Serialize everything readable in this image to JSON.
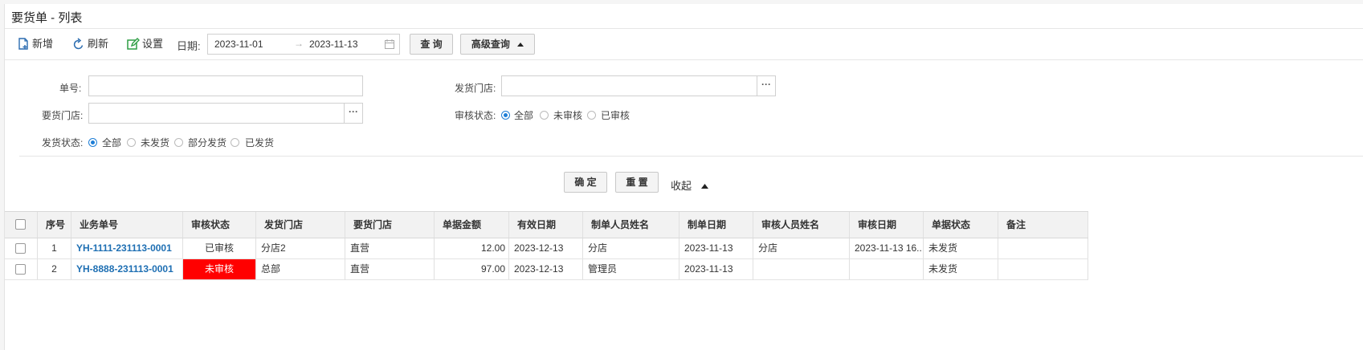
{
  "title": "要货单 - 列表",
  "toolbar": {
    "new_label": "新增",
    "refresh_label": "刷新",
    "settings_label": "设置",
    "date_label": "日期:",
    "date_from": "2023-11-01",
    "date_arrow": "→",
    "date_to": "2023-11-13",
    "query_label": "查 询",
    "advanced_label": "高级查询"
  },
  "filters": {
    "order_no_label": "单号:",
    "ship_store_label": "发货门店:",
    "req_store_label": "要货门店:",
    "audit_status_label": "审核状态:",
    "audit_options": [
      "全部",
      "未审核",
      "已审核"
    ],
    "ship_status_label": "发货状态:",
    "ship_options": [
      "全部",
      "未发货",
      "部分发货",
      "已发货"
    ],
    "ellipsis": "···",
    "confirm_label": "确 定",
    "reset_label": "重 置",
    "collapse_label": "收起"
  },
  "table": {
    "headers": [
      "序号",
      "业务单号",
      "审核状态",
      "发货门店",
      "要货门店",
      "单据金额",
      "有效日期",
      "制单人员姓名",
      "制单日期",
      "审核人员姓名",
      "审核日期",
      "单据状态",
      "备注"
    ],
    "rows": [
      [
        "1",
        "YH-1111-231113-0001",
        "已审核",
        "分店2",
        "直营",
        "12.00",
        "2023-12-13",
        "分店",
        "2023-11-13",
        "分店",
        "2023-11-13 16...",
        "未发货",
        ""
      ],
      [
        "2",
        "YH-8888-231113-0001",
        "未审核",
        "总部",
        "直营",
        "97.00",
        "2023-12-13",
        "管理员",
        "2023-11-13",
        "",
        "",
        "未发货",
        ""
      ]
    ]
  },
  "colors": {
    "accent": "#1e7ed6",
    "link": "#1e6fb3",
    "unaudited_bg": "#ff0000"
  }
}
